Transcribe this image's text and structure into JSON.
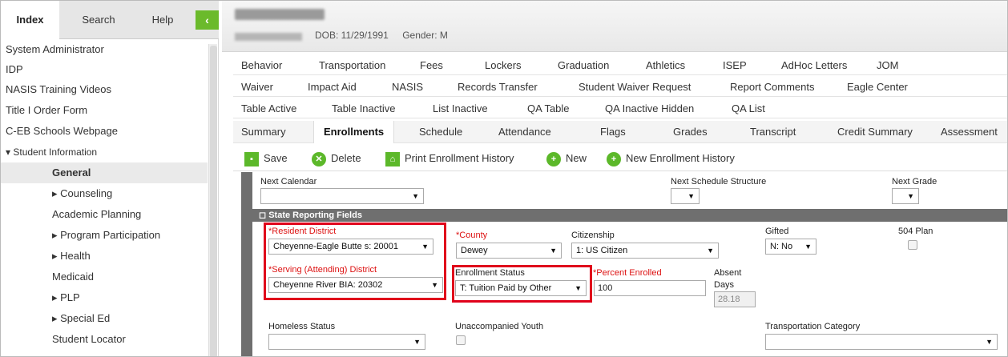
{
  "sidebar": {
    "tabs": [
      {
        "label": "Index"
      },
      {
        "label": "Search"
      },
      {
        "label": "Help"
      }
    ],
    "collapse_icon": "chevron-left-icon",
    "items": [
      {
        "label": "System Administrator"
      },
      {
        "label": "IDP"
      },
      {
        "label": "NASIS Training Videos"
      },
      {
        "label": "Title I Order Form"
      },
      {
        "label": "C-EB Schools Webpage"
      },
      {
        "label": "▾ Student Information"
      },
      {
        "label": "General"
      },
      {
        "label": "▸ Counseling"
      },
      {
        "label": "Academic Planning"
      },
      {
        "label": "▸ Program Participation"
      },
      {
        "label": "▸ Health"
      },
      {
        "label": "Medicaid"
      },
      {
        "label": "▸ PLP"
      },
      {
        "label": "▸ Special Ed"
      },
      {
        "label": "Student Locator"
      }
    ]
  },
  "student": {
    "dob": "DOB: 11/29/1991",
    "gender": "Gender: M"
  },
  "tab_rows": [
    [
      "Behavior",
      "Transportation",
      "Fees",
      "Lockers",
      "Graduation",
      "Athletics",
      "ISEP",
      "AdHoc Letters",
      "JOM"
    ],
    [
      "Waiver",
      "Impact Aid",
      "NASIS",
      "Records Transfer",
      "Student Waiver Request",
      "Report Comments",
      "Eagle Center"
    ],
    [
      "Table Active",
      "Table Inactive",
      "List Inactive",
      "QA Table",
      "QA Inactive Hidden",
      "QA List"
    ],
    [
      "Summary",
      "Enrollments",
      "Schedule",
      "Attendance",
      "Flags",
      "Grades",
      "Transcript",
      "Credit Summary",
      "Assessment"
    ]
  ],
  "toolbar": {
    "save": "Save",
    "delete": "Delete",
    "print": "Print Enrollment History",
    "new": "New",
    "new_history": "New Enrollment History"
  },
  "form": {
    "next_calendar_label": "Next Calendar",
    "next_calendar_value": "",
    "next_schedule_label": "Next Schedule Structure",
    "next_schedule_value": "",
    "next_grade_label": "Next Grade",
    "next_grade_value": "",
    "section_title": "State Reporting Fields",
    "resident_district_label": "*Resident District",
    "resident_district_value": "Cheyenne-Eagle Butte s: 20001",
    "county_label": "*County",
    "county_value": "Dewey",
    "citizenship_label": "Citizenship",
    "citizenship_value": "1: US Citizen",
    "gifted_label": "Gifted",
    "gifted_value": "N: No",
    "plan504_label": "504 Plan",
    "serving_district_label": "*Serving (Attending) District",
    "serving_district_value": "Cheyenne River BIA: 20302",
    "enrollment_status_label": "Enrollment Status",
    "enrollment_status_value": "T: Tuition Paid by Other",
    "percent_enrolled_label": "*Percent Enrolled",
    "percent_enrolled_value": "100",
    "absent_days_label_1": "Absent",
    "absent_days_label_2": "Days",
    "absent_days_value": "28.18",
    "homeless_label": "Homeless Status",
    "homeless_value": "",
    "unaccompanied_label": "Unaccompanied Youth",
    "transport_category_label": "Transportation Category",
    "transport_category_value": ""
  },
  "colors": {
    "accent": "#5cb82a",
    "highlight": "#e0001b",
    "required": "#dd1111"
  }
}
